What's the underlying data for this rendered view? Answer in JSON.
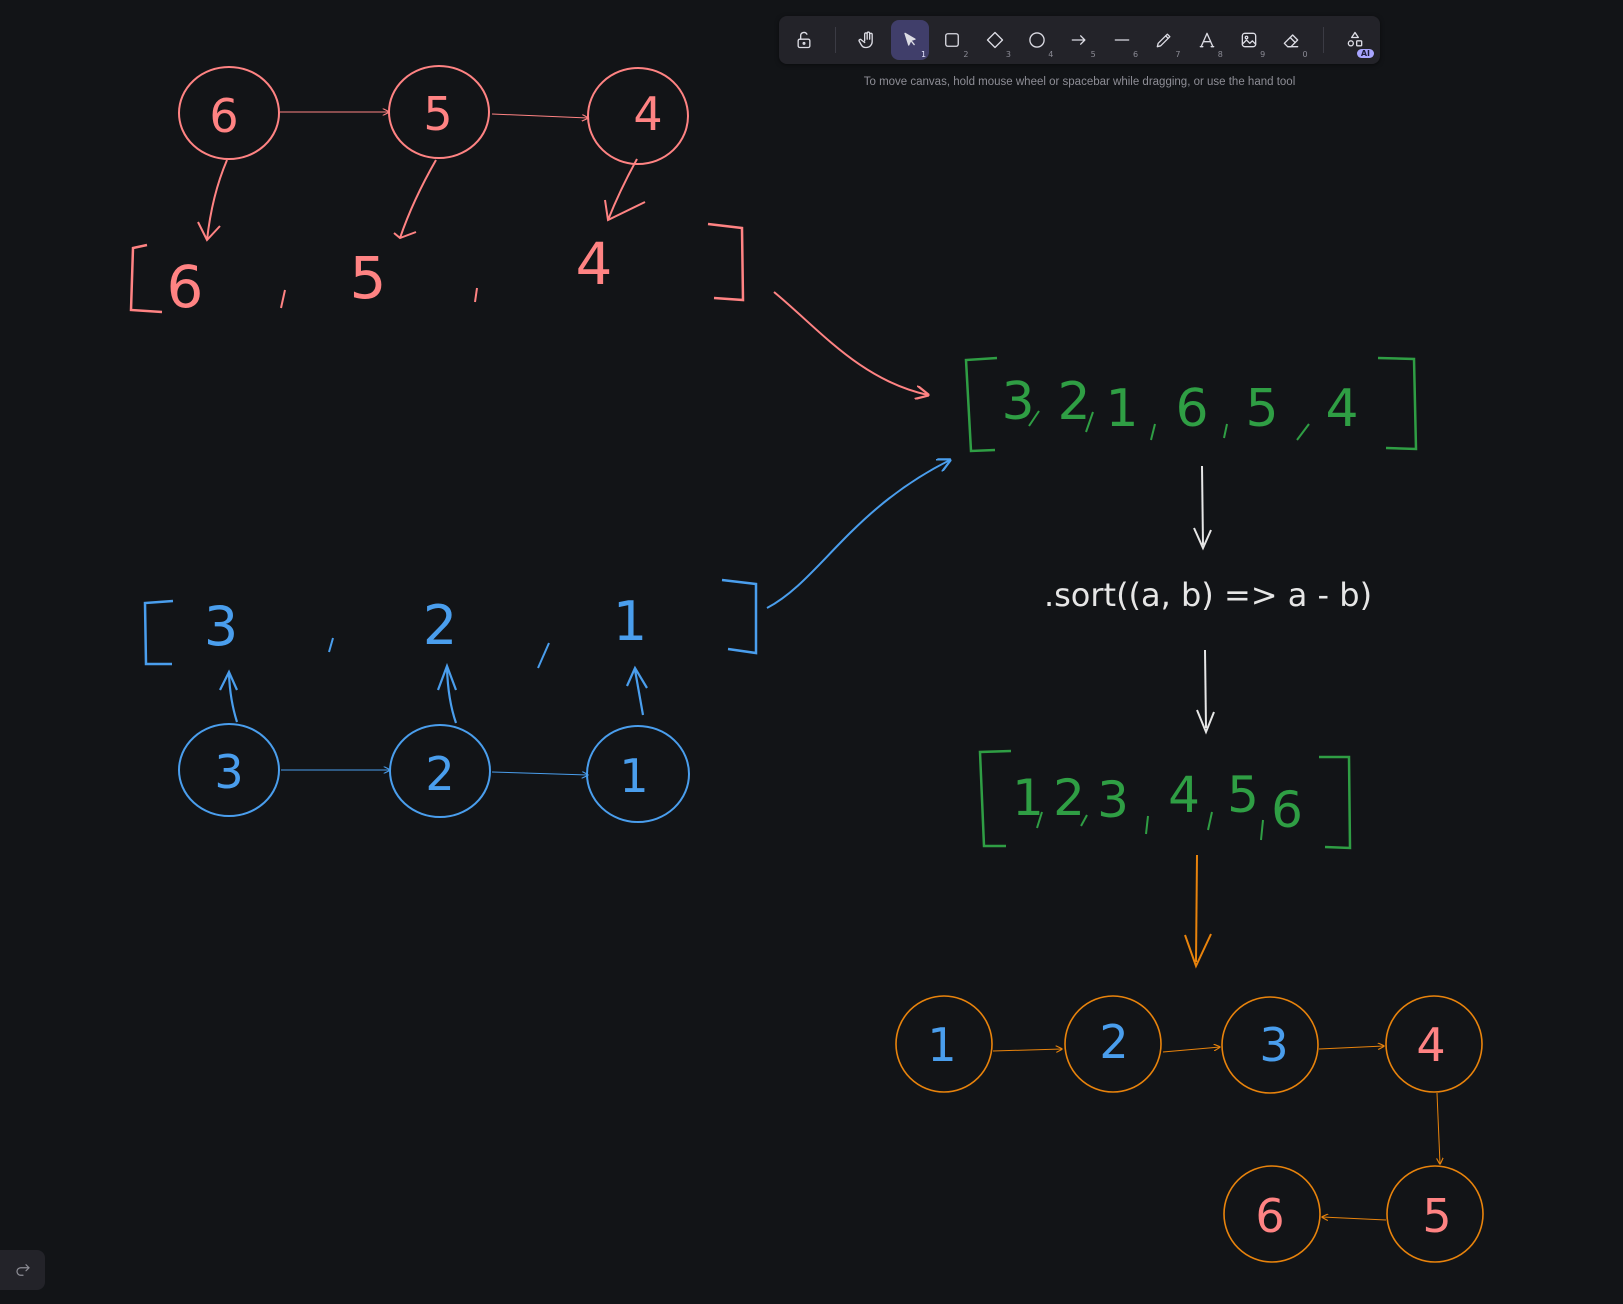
{
  "colors": {
    "red": "#ff8383",
    "blue": "#4a9eed",
    "green": "#2f9e44",
    "white": "#e6e6e6",
    "orange": "#e8830c",
    "background": "#121417"
  },
  "toolbar": {
    "tools": [
      {
        "name": "lock-icon",
        "key": ""
      },
      {
        "name": "hand-icon",
        "key": ""
      },
      {
        "name": "selection-icon",
        "key": "1",
        "active": true
      },
      {
        "name": "rectangle-icon",
        "key": "2"
      },
      {
        "name": "diamond-icon",
        "key": "3"
      },
      {
        "name": "ellipse-icon",
        "key": "4"
      },
      {
        "name": "arrow-icon",
        "key": "5"
      },
      {
        "name": "line-icon",
        "key": "6"
      },
      {
        "name": "pencil-icon",
        "key": "7"
      },
      {
        "name": "text-icon",
        "key": "8"
      },
      {
        "name": "image-icon",
        "key": "9"
      },
      {
        "name": "eraser-icon",
        "key": "0"
      },
      {
        "name": "shapes-library-icon",
        "key": ""
      }
    ],
    "ai_badge": "AI"
  },
  "hint": "To move canvas, hold mouse wheel or spacebar while dragging, or use the hand tool",
  "drawing": {
    "red_list": [
      "6",
      "5",
      "4"
    ],
    "red_array": [
      "6",
      "5",
      "4"
    ],
    "blue_array": [
      "3",
      "2",
      "1"
    ],
    "blue_list": [
      "3",
      "2",
      "1"
    ],
    "merged_array": [
      "3",
      "2",
      "1",
      "6",
      "5",
      "4"
    ],
    "sort_call": ".sort((a, b) => a - b)",
    "sorted_array": [
      "1",
      "2",
      "3",
      "4",
      "5",
      "6"
    ],
    "result_list": [
      "1",
      "2",
      "3",
      "4",
      "5",
      "6"
    ]
  },
  "footer": {
    "redo_icon": "redo-icon"
  }
}
